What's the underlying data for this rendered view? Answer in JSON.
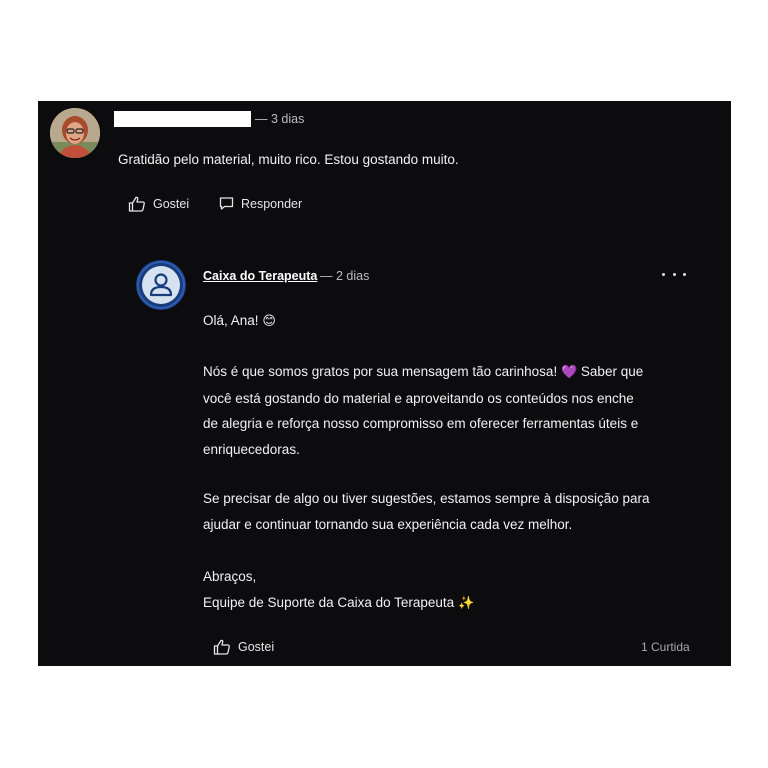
{
  "comment": {
    "time": "— 3 dias",
    "text": "Gratidão pelo material, muito rico. Estou gostando muito.",
    "like_label": "Gostei",
    "reply_label": "Responder"
  },
  "reply": {
    "author": "Caixa do Terapeuta",
    "time": "— 2 dias",
    "greeting": "Olá, Ana!",
    "greeting_emoji": "😊",
    "p1_line1": "Nós é que somos gratos por sua mensagem tão carinhosa!",
    "p1_emoji": "💜",
    "p1_line1b": "Saber que",
    "p1_line2": "você está gostando do material e aproveitando os conteúdos nos enche",
    "p1_line3": "de alegria e reforça nosso compromisso em oferecer ferramentas úteis e",
    "p1_line4": "enriquecedoras.",
    "p2_line1": "Se precisar de algo ou tiver sugestões, estamos sempre à disposição para",
    "p2_line2": "ajudar e continuar tornando sua experiência cada vez melhor.",
    "signoff": "Abraços,",
    "signature": "Equipe de Suporte da Caixa do Terapeuta",
    "signature_emoji": "✨",
    "like_label": "Gostei",
    "likes_count": "1 Curtida"
  },
  "colors": {
    "background": "#0c0c0e",
    "brand_blue": "#1f4e9c"
  }
}
